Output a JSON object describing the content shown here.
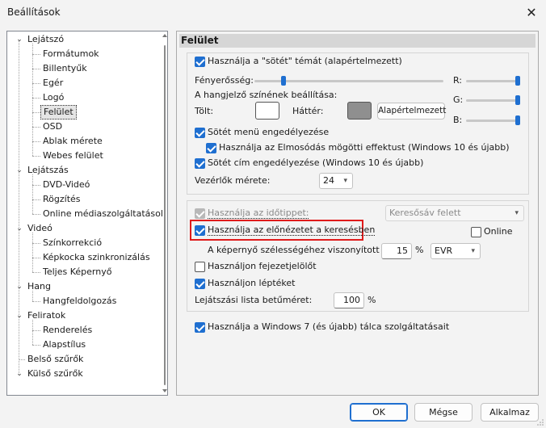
{
  "window": {
    "title": "Beállítások"
  },
  "tree": {
    "items": [
      {
        "label": "Lejátszó",
        "level": 0,
        "expanded": true
      },
      {
        "label": "Formátumok",
        "level": 1
      },
      {
        "label": "Billentyűk",
        "level": 1
      },
      {
        "label": "Egér",
        "level": 1
      },
      {
        "label": "Logó",
        "level": 1
      },
      {
        "label": "Felület",
        "level": 1,
        "selected": true
      },
      {
        "label": "OSD",
        "level": 1
      },
      {
        "label": "Ablak mérete",
        "level": 1
      },
      {
        "label": "Webes felület",
        "level": 1
      },
      {
        "label": "Lejátszás",
        "level": 0,
        "expanded": true
      },
      {
        "label": "DVD-Videó",
        "level": 1
      },
      {
        "label": "Rögzítés",
        "level": 1
      },
      {
        "label": "Online médiaszolgáltatásol",
        "level": 1
      },
      {
        "label": "Videó",
        "level": 0,
        "expanded": true
      },
      {
        "label": "Színkorrekció",
        "level": 1
      },
      {
        "label": "Képkocka szinkronizálás",
        "level": 1
      },
      {
        "label": "Teljes Képernyő",
        "level": 1
      },
      {
        "label": "Hang",
        "level": 0,
        "expanded": true
      },
      {
        "label": "Hangfeldolgozás",
        "level": 1
      },
      {
        "label": "Feliratok",
        "level": 0,
        "expanded": true
      },
      {
        "label": "Renderelés",
        "level": 1
      },
      {
        "label": "Alapstílus",
        "level": 1
      },
      {
        "label": "Belső szűrők",
        "level": 0
      },
      {
        "label": "Külső szűrők",
        "level": 0,
        "expanded": true
      }
    ]
  },
  "panel": {
    "header": "Felület",
    "dark_theme": {
      "label": "Használja a \"sötét\" témát (alapértelmezett)",
      "checked": true
    },
    "brightness_label": "Fényerősség:",
    "brightness_value": 0.27,
    "tint_label": "A hangjelző színének beállítása:",
    "fill_label": "Tölt:",
    "bg_label": "Háttér:",
    "fill_color": "#ffffff",
    "bg_color": "#8f8f8f",
    "default_button": "Alapértelmezett",
    "r_label": "R:",
    "g_label": "G:",
    "b_label": "B:",
    "r_value": 1.0,
    "g_value": 1.0,
    "b_value": 1.0,
    "dark_menu": {
      "label": "Sötét menü engedélyezése",
      "checked": true
    },
    "blur_effect": {
      "label": "Használja az Elmosódás mögötti effektust (Windows 10 és újabb)",
      "checked": true
    },
    "dark_title": {
      "label": "Sötét cím engedélyezése (Windows 10 és újabb)",
      "checked": true
    },
    "controls_size_label": "Vezérlők mérete:",
    "controls_size_value": "24",
    "timetip": {
      "label": "Használja az időtippet:",
      "checked": true,
      "disabled": true
    },
    "timetip_select": "Keresősáv felett",
    "preview": {
      "label": "Használja az előnézetet a keresésben",
      "checked": true
    },
    "online": {
      "label": "Online",
      "checked": false
    },
    "preview_width_label": "A képernyő szélességéhez viszonyított",
    "preview_width_value": "15",
    "percent": "%",
    "renderer_value": "EVR",
    "chapter_marks": {
      "label": "Használjon fejezetjelölőt",
      "checked": false
    },
    "scale": {
      "label": "Használjon léptéket",
      "checked": true
    },
    "playlist_font_label": "Lejátszási lista betűméret:",
    "playlist_font_value": "100",
    "taskbar": {
      "label": "Használja a Windows 7 (és újabb) tálca szolgáltatásait",
      "checked": true
    }
  },
  "buttons": {
    "ok": "OK",
    "cancel": "Mégse",
    "apply": "Alkalmaz"
  },
  "colors": {
    "accent": "#1f6fd0",
    "highlight": "#e01b1b"
  }
}
